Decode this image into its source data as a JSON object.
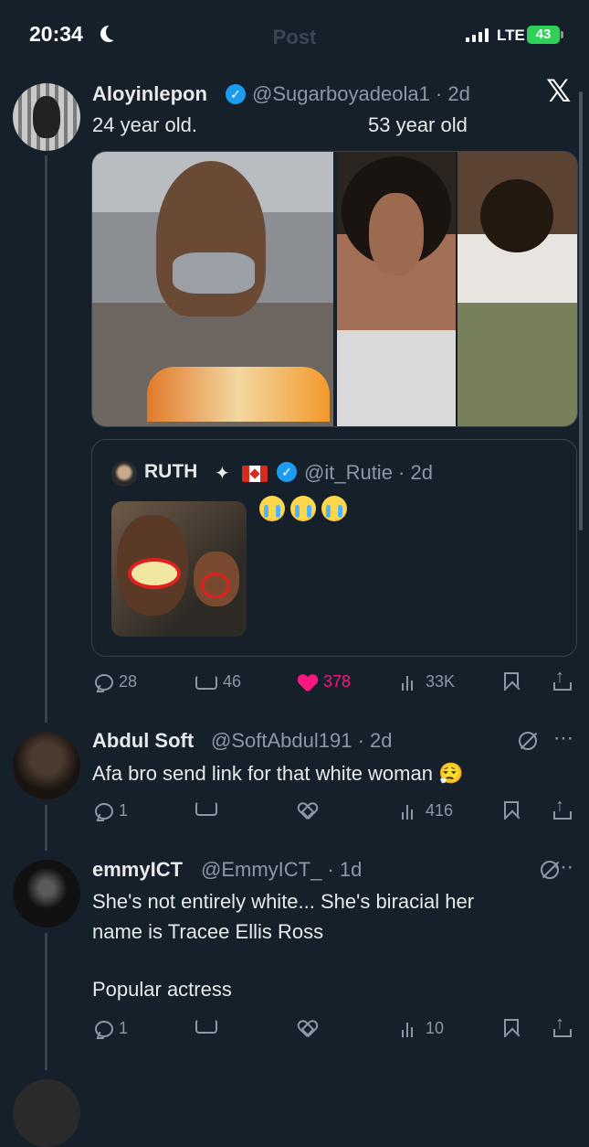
{
  "status_bar": {
    "time": "20:34",
    "network": "LTE",
    "battery": "43"
  },
  "header": {
    "title": "Post"
  },
  "main_post": {
    "display_name": "Aloyinlepon",
    "handle": "@Sugarboyadeola1",
    "time": "2d",
    "text_left": "24 year old.",
    "text_right": "53 year old",
    "stats": {
      "replies": "28",
      "reposts": "46",
      "likes": "378",
      "views": "33K"
    }
  },
  "quoted_post": {
    "display_name": "RUTH",
    "handle": "@it_Rutie",
    "time": "2d",
    "emoji_text": "😭😭😭"
  },
  "replies": [
    {
      "display_name": "Abdul Soft",
      "handle": "@SoftAbdul191",
      "time": "2d",
      "text": "Afa bro send link for that white woman 😮‍💨",
      "stats": {
        "replies": "1",
        "reposts": "",
        "likes": "",
        "views": "416"
      }
    },
    {
      "display_name": "emmyICT",
      "handle": "@EmmyICT_",
      "time": "1d",
      "text_line1": "She's not entirely white... She's biracial her",
      "text_line2": "name is Tracee Ellis Ross",
      "text_line3": "Popular actress",
      "stats": {
        "replies": "1",
        "reposts": "",
        "likes": "",
        "views": "10"
      }
    }
  ],
  "colors": {
    "background": "#15202b",
    "accent": "#1d9bf0",
    "like": "#f91880",
    "muted": "#8b98a5"
  },
  "icons": [
    "verified-badge-icon",
    "x-logo-icon",
    "reply-icon",
    "repost-icon",
    "heart-icon",
    "views-icon",
    "bookmark-icon",
    "share-icon",
    "grok-icon",
    "more-icon"
  ]
}
